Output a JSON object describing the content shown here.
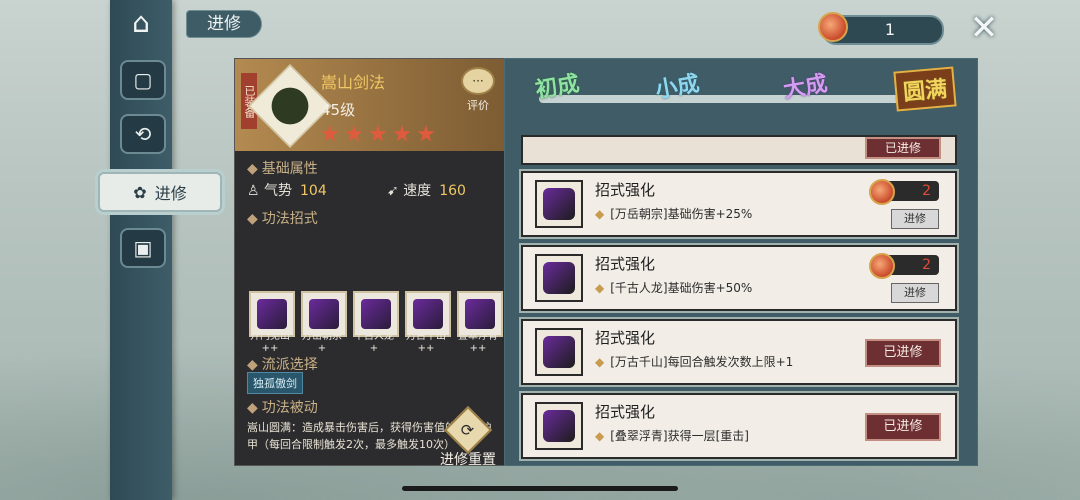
{
  "screen": {
    "title": "进修"
  },
  "currency": {
    "amount": "1",
    "accent": "#c94a2a"
  },
  "sidebar": {
    "items": [
      {
        "name": "home-icon",
        "glyph": "⌂"
      },
      {
        "name": "cards-icon",
        "glyph": "▢"
      },
      {
        "name": "rotate-icon",
        "glyph": "⟲"
      },
      {
        "name": "advance",
        "label": "进修"
      },
      {
        "name": "scroll-icon",
        "glyph": "▣"
      }
    ]
  },
  "skill": {
    "equipped_tag": "已装备",
    "name": "嵩山剑法",
    "level": "45级",
    "stars": 5,
    "rate_label": "评价",
    "rate_icon": "···"
  },
  "sections": {
    "base_attr": "基础属性",
    "moves": "功法招式",
    "school": "流派选择",
    "passive": "功法被动"
  },
  "stats": [
    {
      "label": "气势",
      "value": "104",
      "icon": "qishi-icon"
    },
    {
      "label": "速度",
      "value": "160",
      "icon": "speed-icon"
    }
  ],
  "moves": [
    {
      "label": "开门见山",
      "plus": "++"
    },
    {
      "label": "万岳朝宗",
      "plus": "+"
    },
    {
      "label": "千古人龙",
      "plus": "+"
    },
    {
      "label": "万古千山",
      "plus": "++"
    },
    {
      "label": "叠翠浮青",
      "plus": "++"
    }
  ],
  "school_choice": "独孤傲剑",
  "passive_text": "嵩山圆满：造成暴击伤害后，获得伤害值的15%护甲（每回合限制触发2次，最多触发10次）",
  "reset": {
    "label": "进修重置"
  },
  "tiers": [
    {
      "label": "初成",
      "color": "#8fe3a2"
    },
    {
      "label": "小成",
      "color": "#8ed7ee"
    },
    {
      "label": "大成",
      "color": "#d39bf2"
    },
    {
      "label": "圆满",
      "color": "#f2d55d"
    }
  ],
  "cards": [
    {
      "title": "招式强化",
      "desc": "[万岳朝宗]基础伤害+25%",
      "cost": "2",
      "action": "进修",
      "done": false
    },
    {
      "title": "招式强化",
      "desc": "[千古人龙]基础伤害+50%",
      "cost": "2",
      "action": "进修",
      "done": false
    },
    {
      "title": "招式强化",
      "desc": "[万古千山]每回合触发次数上限+1",
      "action": "已进修",
      "done": true
    },
    {
      "title": "招式强化",
      "desc": "[叠翠浮青]获得一层[重击]",
      "action": "已进修",
      "done": true
    }
  ],
  "partial_card": {
    "action": "已进修"
  }
}
